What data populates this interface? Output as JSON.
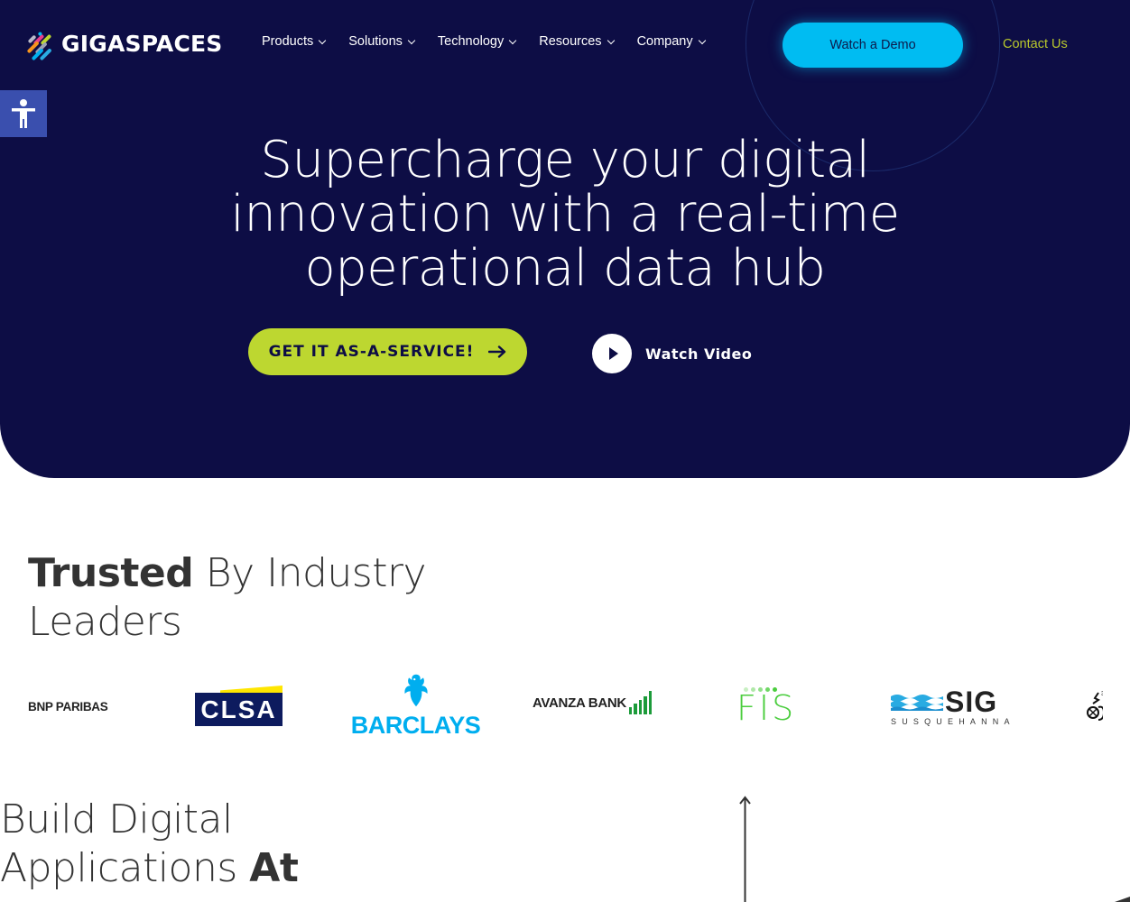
{
  "header": {
    "brand": "GIGASPACES",
    "nav": [
      {
        "label": "Products"
      },
      {
        "label": "Solutions"
      },
      {
        "label": "Technology"
      },
      {
        "label": "Resources"
      },
      {
        "label": "Company"
      }
    ],
    "demo_button": "Watch a Demo",
    "contact_link": "Contact Us"
  },
  "accessibility": {
    "icon": "accessibility-icon",
    "label": "Accessibility tools"
  },
  "hero": {
    "title_lines": [
      "Supercharge your digital",
      "innovation with a real-time",
      "operational data hub"
    ],
    "cta_button": "GET IT AS-A-SERVICE!",
    "cta_icon": "arrow-right-icon",
    "watch_video": "Watch Video",
    "watch_icon": "play-icon"
  },
  "trusted": {
    "title_bold": "Trusted",
    "title_rest_line1": " By Industry",
    "title_line2": "Leaders",
    "logos": [
      {
        "name": "BNP PARIBAS",
        "text": "BNP PARIBAS"
      },
      {
        "name": "CLSA",
        "text": "CLSA"
      },
      {
        "name": "Barclays",
        "text": "BARCLAYS"
      },
      {
        "name": "Avanza Bank",
        "text": "AVANZA BANK"
      },
      {
        "name": "FIS",
        "text": "FIS"
      },
      {
        "name": "SIG Susquehanna",
        "text": "SIG",
        "subtext": "SUSQUEHANNA"
      }
    ]
  },
  "build": {
    "line1": "Build Digital",
    "line2_regular": "Applications ",
    "line2_bold": "At"
  },
  "colors": {
    "hero_bg": "#0d0d45",
    "demo_button": "#00bcf2",
    "cta_button": "#bdd730",
    "contact_link": "#b9c82c",
    "accessibility_bg": "#3a4fae",
    "heading_text": "#333333"
  }
}
